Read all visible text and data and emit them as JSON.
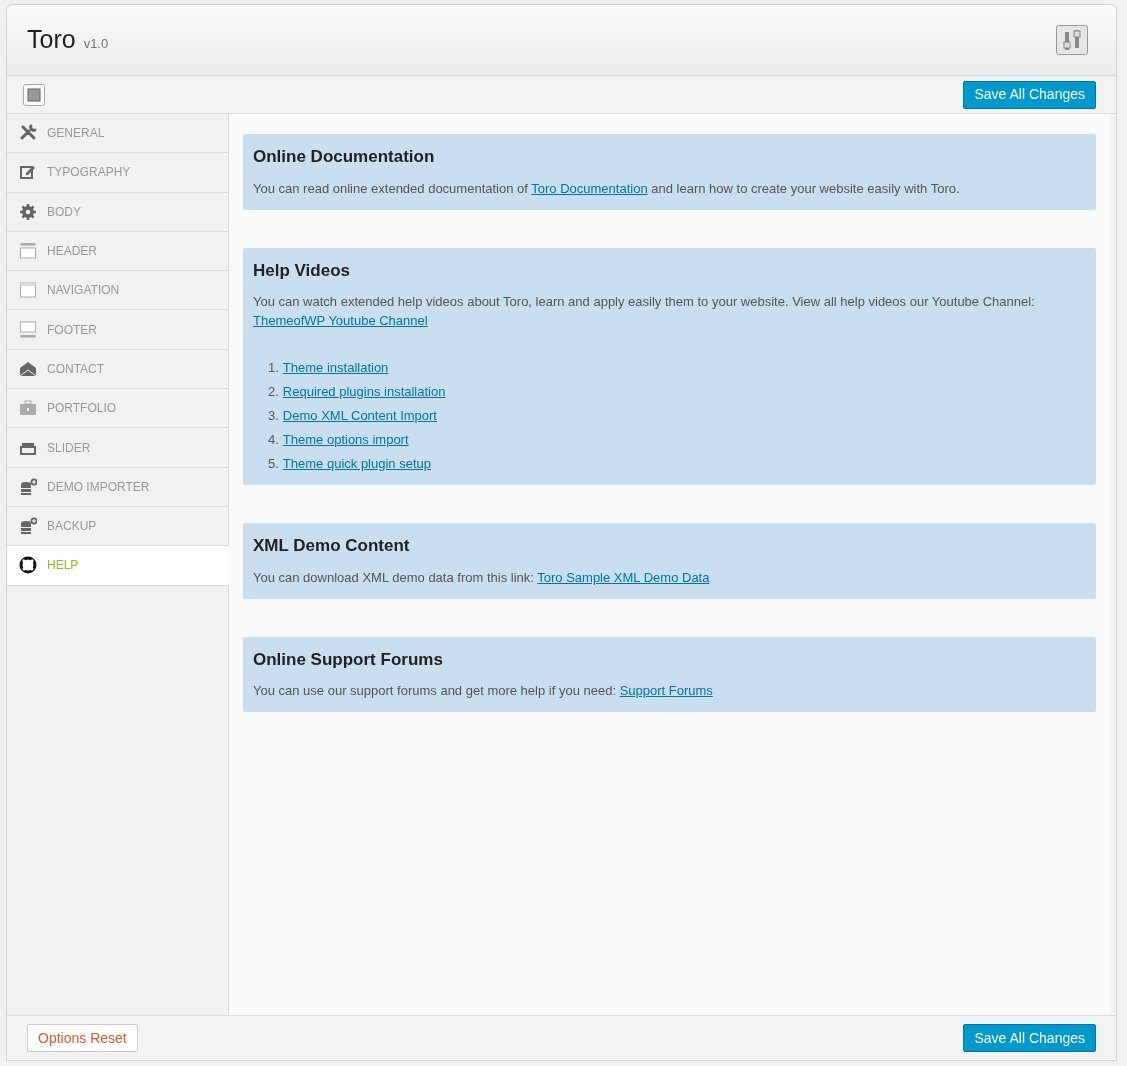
{
  "header": {
    "title": "Toro",
    "version": "v1.0"
  },
  "toolbar": {
    "save_button": "Save All Changes"
  },
  "sidebar": {
    "items": [
      {
        "label": "GENERAL",
        "selected": false
      },
      {
        "label": "TYPOGRAPHY",
        "selected": false
      },
      {
        "label": "BODY",
        "selected": false
      },
      {
        "label": "HEADER",
        "selected": false
      },
      {
        "label": "NAVIGATION",
        "selected": false
      },
      {
        "label": "FOOTER",
        "selected": false
      },
      {
        "label": "CONTACT",
        "selected": false
      },
      {
        "label": "PORTFOLIO",
        "selected": false
      },
      {
        "label": "SLIDER",
        "selected": false
      },
      {
        "label": "DEMO IMPORTER",
        "selected": false
      },
      {
        "label": "BACKUP",
        "selected": false
      },
      {
        "label": "HELP",
        "selected": true
      }
    ]
  },
  "sections": [
    {
      "title": "Online Documentation",
      "paragraph": [
        {
          "kind": "text",
          "text": "You can read online extended documentation of "
        },
        {
          "kind": "link",
          "text": "Toro Documentation"
        },
        {
          "kind": "text",
          "text": " and learn how to create your website easily with Toro."
        }
      ]
    },
    {
      "title": "Help Videos",
      "paragraph": [
        {
          "kind": "text",
          "text": "You can watch extended help videos about Toro, learn and apply easily them to your website. View all help videos our Youtube Channel: "
        },
        {
          "kind": "link",
          "text": "ThemeofWP Youtube Channel"
        }
      ],
      "list": [
        {
          "number": "1.",
          "text": "Theme installation"
        },
        {
          "number": "2.",
          "text": "Required plugins installation"
        },
        {
          "number": "3.",
          "text": "Demo XML Content Import"
        },
        {
          "number": "4.",
          "text": "Theme options import"
        },
        {
          "number": "5.",
          "text": "Theme quick plugin setup"
        }
      ]
    },
    {
      "title": "XML Demo Content",
      "paragraph": [
        {
          "kind": "text",
          "text": "You can download XML demo data from this link: "
        },
        {
          "kind": "link",
          "text": "Toro Sample XML Demo Data"
        }
      ]
    },
    {
      "title": "Online Support Forums",
      "paragraph": [
        {
          "kind": "text",
          "text": "You can use our support forums and get more help if you need: "
        },
        {
          "kind": "link",
          "text": "Support Forums"
        }
      ]
    }
  ],
  "footer": {
    "reset_button": "Options Reset",
    "save_button": "Save All Changes"
  }
}
